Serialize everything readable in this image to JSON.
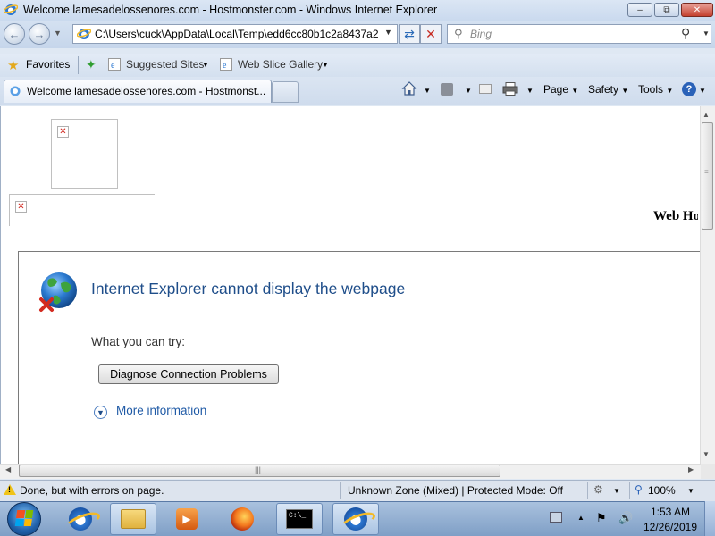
{
  "window": {
    "title": "Welcome lamesadelossenores.com - Hostmonster.com - Windows Internet Explorer",
    "minimize": "–",
    "maximize": "⧉",
    "close": "✕"
  },
  "address_bar": {
    "url": "C:\\Users\\cuck\\AppData\\Local\\Temp\\edd6cc80b1c2a8437a2c",
    "search_placeholder": "Bing"
  },
  "favorites_bar": {
    "favorites_label": "Favorites",
    "suggested_sites_label": "Suggested Sites",
    "web_slice_gallery_label": "Web Slice Gallery"
  },
  "tabs": {
    "active_label": "Welcome lamesadelossenores.com - Hostmonst..."
  },
  "command_bar": {
    "page_label": "Page",
    "safety_label": "Safety",
    "tools_label": "Tools",
    "help_label": "?"
  },
  "page": {
    "header_fragment": "Web Ho"
  },
  "error": {
    "title": "Internet Explorer cannot display the webpage",
    "try_label": "What you can try:",
    "diagnose_button": "Diagnose Connection Problems",
    "more_info_label": "More information"
  },
  "status_bar": {
    "status_text": "Done, but with errors on page.",
    "zone_text": "Unknown Zone (Mixed) | Protected Mode: Off",
    "zoom_text": "100%"
  },
  "taskbar": {
    "clock_time": "1:53 AM",
    "clock_date": "12/26/2019",
    "cmd_text": "C:\\_"
  },
  "colors": {
    "error_title": "#1f4e8a",
    "link": "#1f5aa6",
    "titlebar": "#c9d9ee",
    "taskbar": "#7f9fc6"
  },
  "icons": {
    "title": "ie-icon",
    "back": "back-arrow-icon",
    "forward": "forward-arrow-icon",
    "refresh": "refresh-icon",
    "stop": "stop-icon",
    "search": "magnifier-icon",
    "favorites": "star-icon",
    "error": "globe-error-icon",
    "warning": "warning-icon"
  }
}
